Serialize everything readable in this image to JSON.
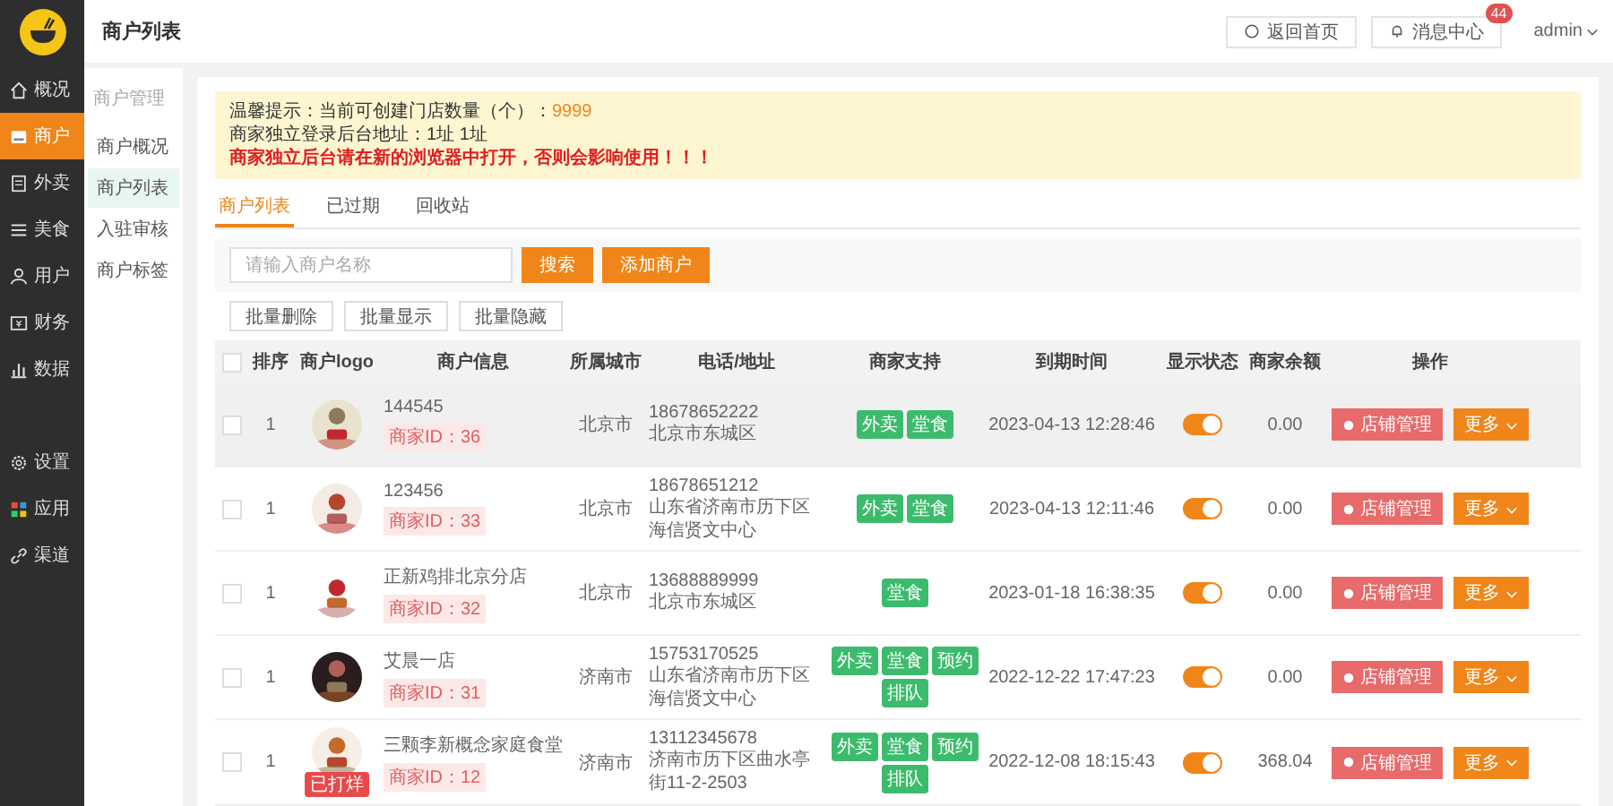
{
  "nav": {
    "main": [
      {
        "label": "概况",
        "selected": false
      },
      {
        "label": "商户",
        "selected": true
      },
      {
        "label": "外卖",
        "selected": false
      },
      {
        "label": "美食",
        "selected": false
      },
      {
        "label": "用户",
        "selected": false
      },
      {
        "label": "财务",
        "selected": false
      },
      {
        "label": "数据",
        "selected": false
      }
    ],
    "extra": [
      {
        "label": "设置",
        "selected": false
      },
      {
        "label": "应用",
        "selected": false
      },
      {
        "label": "渠道",
        "selected": false
      }
    ]
  },
  "subnav": {
    "heading": "商户管理",
    "items": [
      {
        "label": "商户概况",
        "selected": false
      },
      {
        "label": "商户列表",
        "selected": true
      },
      {
        "label": "入驻审核",
        "selected": false
      },
      {
        "label": "商户标签",
        "selected": false
      }
    ]
  },
  "header": {
    "title": "商户列表",
    "home_button": "返回首页",
    "messages_button": "消息中心",
    "messages_badge": "44",
    "user": "admin"
  },
  "notice": [
    {
      "kind": "info",
      "text": "温馨提示：当前可创建门店数量（个）：",
      "value": "9999"
    },
    {
      "kind": "info",
      "text": "商家独立登录后台地址：1址 1址"
    },
    {
      "kind": "warning",
      "text": "商家独立后台请在新的浏览器中打开，否则会影响使用！！！"
    }
  ],
  "tabs": [
    {
      "label": "商户列表",
      "selected": true
    },
    {
      "label": "已过期",
      "selected": false
    },
    {
      "label": "回收站",
      "selected": false
    }
  ],
  "search": {
    "placeholder": "请输入商户名称",
    "search_button": "搜索",
    "add_button": "添加商户"
  },
  "batch_buttons": [
    "批量删除",
    "批量显示",
    "批量隐藏"
  ],
  "table": {
    "select_all": {
      "checked": false
    },
    "columns": [
      "排序",
      "商户logo",
      "商户信息",
      "所属城市",
      "电话/地址",
      "商家支持",
      "到期时间",
      "显示状态",
      "商家余额",
      "操作"
    ],
    "rows": [
      {
        "checked": false,
        "hovered": true,
        "sort": "1",
        "name": "144545",
        "merchant_id": "商家ID：36",
        "city": "北京市",
        "phone": "18678652222",
        "address": "北京市东城区",
        "support": [
          "外卖",
          "堂食"
        ],
        "expires": "2023-04-13 12:28:46",
        "shown": true,
        "balance": "0.00",
        "manage": "店铺管理",
        "more": "更多"
      },
      {
        "checked": false,
        "hovered": false,
        "sort": "1",
        "name": "123456",
        "merchant_id": "商家ID：33",
        "city": "北京市",
        "phone": "18678651212",
        "address": "山东省济南市历下区海信贤文中心",
        "support": [
          "外卖",
          "堂食"
        ],
        "expires": "2023-04-13 12:11:46",
        "shown": true,
        "balance": "0.00",
        "manage": "店铺管理",
        "more": "更多"
      },
      {
        "checked": false,
        "hovered": false,
        "sort": "1",
        "name": "正新鸡排北京分店",
        "merchant_id": "商家ID：32",
        "city": "北京市",
        "phone": "13688889999",
        "address": "北京市东城区",
        "support": [
          "堂食"
        ],
        "expires": "2023-01-18 16:38:35",
        "shown": true,
        "balance": "0.00",
        "manage": "店铺管理",
        "more": "更多"
      },
      {
        "checked": false,
        "hovered": false,
        "sort": "1",
        "name": "艾晨一店",
        "merchant_id": "商家ID：31",
        "city": "济南市",
        "phone": "15753170525",
        "address": "山东省济南市历下区海信贤文中心",
        "support": [
          "外卖",
          "堂食",
          "预约",
          "排队"
        ],
        "expires": "2022-12-22 17:47:23",
        "shown": true,
        "balance": "0.00",
        "manage": "店铺管理",
        "more": "更多"
      },
      {
        "checked": false,
        "hovered": false,
        "sort": "1",
        "name": "三颗李新概念家庭食堂",
        "merchant_id": "商家ID：12",
        "status_badge": "已打烊",
        "city": "济南市",
        "phone": "13112345678",
        "address": "济南市历下区曲水亭街11-2-2503",
        "support": [
          "外卖",
          "堂食",
          "预约",
          "排队"
        ],
        "expires": "2022-12-08 18:15:43",
        "shown": true,
        "balance": "368.04",
        "manage": "店铺管理",
        "more": "更多"
      }
    ]
  }
}
